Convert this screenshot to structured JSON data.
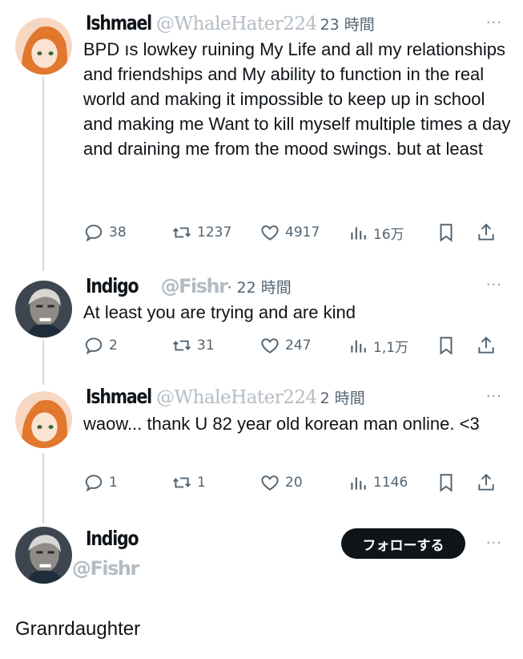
{
  "posts": [
    {
      "name": "Ishmael",
      "handle": "@WhaleHater224",
      "time": "23 時間",
      "text": "BPD ıs lowkey ruining My Life and all my relationships and friendships and My ability to function in the real world and making it impossible to keep up in school  and making me Want to kill myself multiple times a day and draining me from the mood swings. but at least",
      "replies": "38",
      "reposts": "1237",
      "likes": "4917",
      "views": "16万"
    },
    {
      "name": "Indigo",
      "handle": "@Fishr",
      "time": "· 22 時間",
      "text": "At least you are trying and are kind",
      "replies": "2",
      "reposts": "31",
      "likes": "247",
      "views": "1,1万"
    },
    {
      "name": "Ishmael",
      "handle": "@WhaleHater224",
      "time": "2 時間",
      "text": "waow... thank U 82 year old korean man online. <3",
      "replies": "1",
      "reposts": "1",
      "likes": "20",
      "views": "1146"
    },
    {
      "name": "Indigo",
      "handle": "@Fishr",
      "follow_label": "フォローする",
      "text": "Granrdaughter"
    }
  ],
  "more_label": "···",
  "icons": {
    "reply": "reply-icon",
    "repost": "repost-icon",
    "like": "heart-icon",
    "views": "views-icon",
    "bookmark": "bookmark-icon",
    "share": "share-icon"
  },
  "colors": {
    "text": "#0f1419",
    "muted": "#536471",
    "handle": "#b4bcc3",
    "thread": "#cfd9de"
  }
}
